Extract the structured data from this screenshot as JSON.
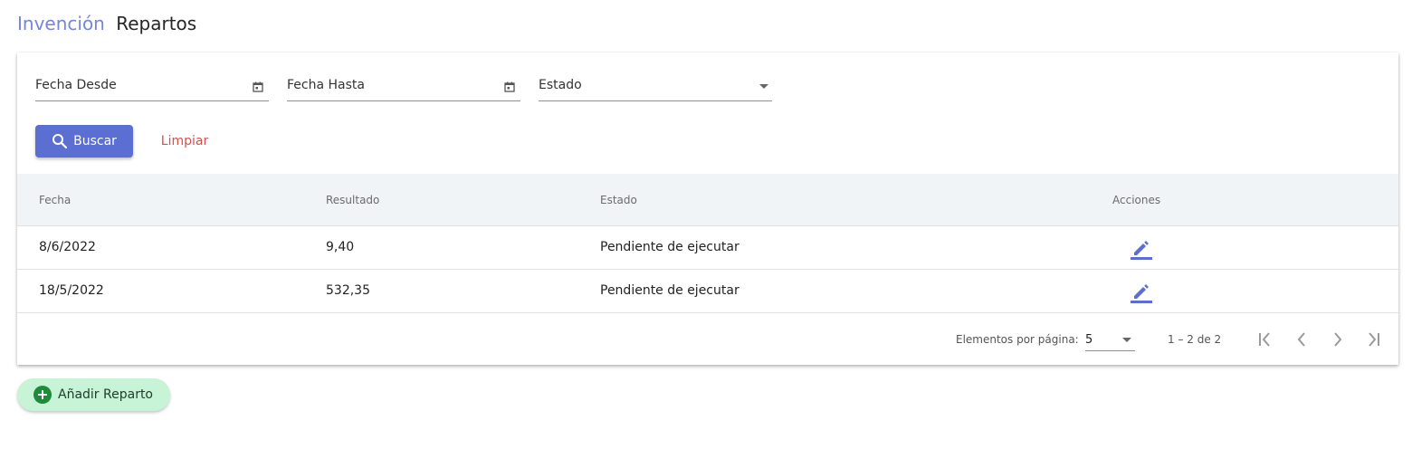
{
  "breadcrumb": {
    "parent": "Invención",
    "current": "Repartos"
  },
  "filters": {
    "fecha_desde": "Fecha Desde",
    "fecha_hasta": "Fecha Hasta",
    "estado": "Estado",
    "buscar_label": "Buscar",
    "limpiar_label": "Limpiar"
  },
  "table": {
    "headers": [
      "Fecha",
      "Resultado",
      "Estado",
      "Acciones"
    ],
    "rows": [
      {
        "fecha": "8/6/2022",
        "resultado": "9,40",
        "estado": "Pendiente de ejecutar",
        "accion_icon": "edit-icon"
      },
      {
        "fecha": "18/5/2022",
        "resultado": "532,35",
        "estado": "Pendiente de ejecutar",
        "accion_icon": "edit-icon"
      }
    ]
  },
  "paginator": {
    "label": "Elementos por página:",
    "page_size": "5",
    "range": "1 – 2 de 2"
  },
  "add_button": {
    "label": "Añadir Reparto"
  },
  "colors": {
    "primary": "#5a6fd1",
    "breadcrumb_link": "#7686d4",
    "danger": "#e04b4b",
    "add_bg": "#c7f3d7",
    "add_icon": "#1e8b3a",
    "header_bg": "#f1f4f7"
  }
}
